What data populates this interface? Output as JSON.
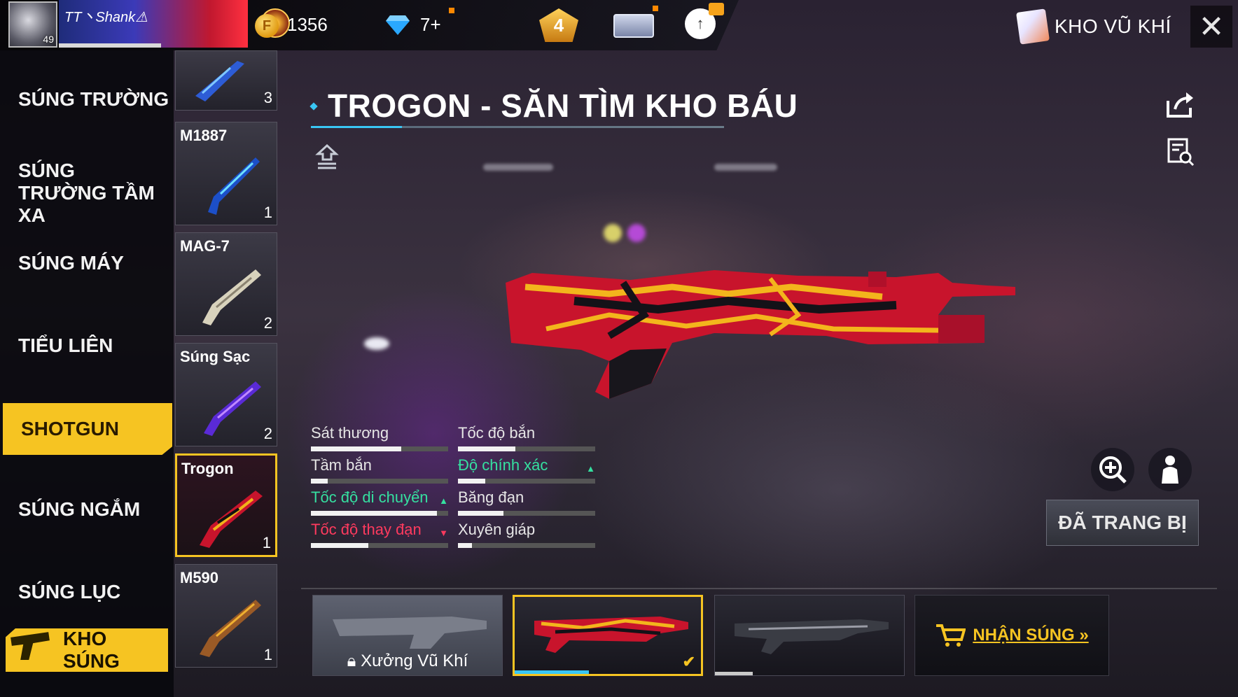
{
  "header": {
    "player_name": "TT丶Shank⚠",
    "player_level": "49",
    "coins": "1356",
    "diamonds": "7+",
    "rank_badge": "4",
    "section_title": "KHO VŨ KHÍ",
    "icons": [
      "coin-icon",
      "diamond-icon",
      "rank-badge-icon",
      "membership-card-icon",
      "cloud-gift-icon",
      "book-icon",
      "close-icon"
    ]
  },
  "categories": [
    {
      "label": "SÚNG TRƯỜNG"
    },
    {
      "label": "SÚNG TRƯỜNG TẦM XA"
    },
    {
      "label": "SÚNG MÁY"
    },
    {
      "label": "TIỂU LIÊN"
    },
    {
      "label": "SHOTGUN",
      "active": true
    },
    {
      "label": "SÚNG NGẮM"
    },
    {
      "label": "SÚNG LỤC"
    }
  ],
  "kho_sung_label": "KHO SÚNG",
  "weapons": [
    {
      "name": "",
      "count": "3"
    },
    {
      "name": "M1887",
      "count": "1"
    },
    {
      "name": "MAG-7",
      "count": "2"
    },
    {
      "name": "Súng Sạc",
      "count": "2"
    },
    {
      "name": "Trogon",
      "count": "1",
      "selected": true
    },
    {
      "name": "M590",
      "count": "1"
    }
  ],
  "weapon_title": "TROGON - SĂN TÌM KHO BÁU",
  "stats": [
    {
      "label": "Sát thương",
      "level": 0.66,
      "trend": "none"
    },
    {
      "label": "Tốc độ bắn",
      "level": 0.42,
      "trend": "none"
    },
    {
      "label": "Tầm bắn",
      "level": 0.12,
      "trend": "none"
    },
    {
      "label": "Độ chính xác",
      "level": 0.2,
      "trend": "up"
    },
    {
      "label": "Tốc độ di chuyển",
      "level": 0.92,
      "trend": "up"
    },
    {
      "label": "Băng đạn",
      "level": 0.33,
      "trend": "none"
    },
    {
      "label": "Tốc độ thay đạn",
      "level": 0.42,
      "trend": "down"
    },
    {
      "label": "Xuyên giáp",
      "level": 0.1,
      "trend": "none"
    }
  ],
  "equipped_label": "ĐÃ TRANG BỊ",
  "skins": [
    {
      "label": "Xưởng Vũ Khí",
      "locked": true
    },
    {
      "label": "",
      "selected": true,
      "progress": 0.4
    },
    {
      "label": "",
      "progress": 0.2
    }
  ],
  "get_gun_label": "NHẬN SÚNG »",
  "colors": {
    "accent": "#f6c422",
    "highlight": "#39c6f4",
    "stat_up": "#35e0a0",
    "stat_down": "#ff3a5e"
  }
}
